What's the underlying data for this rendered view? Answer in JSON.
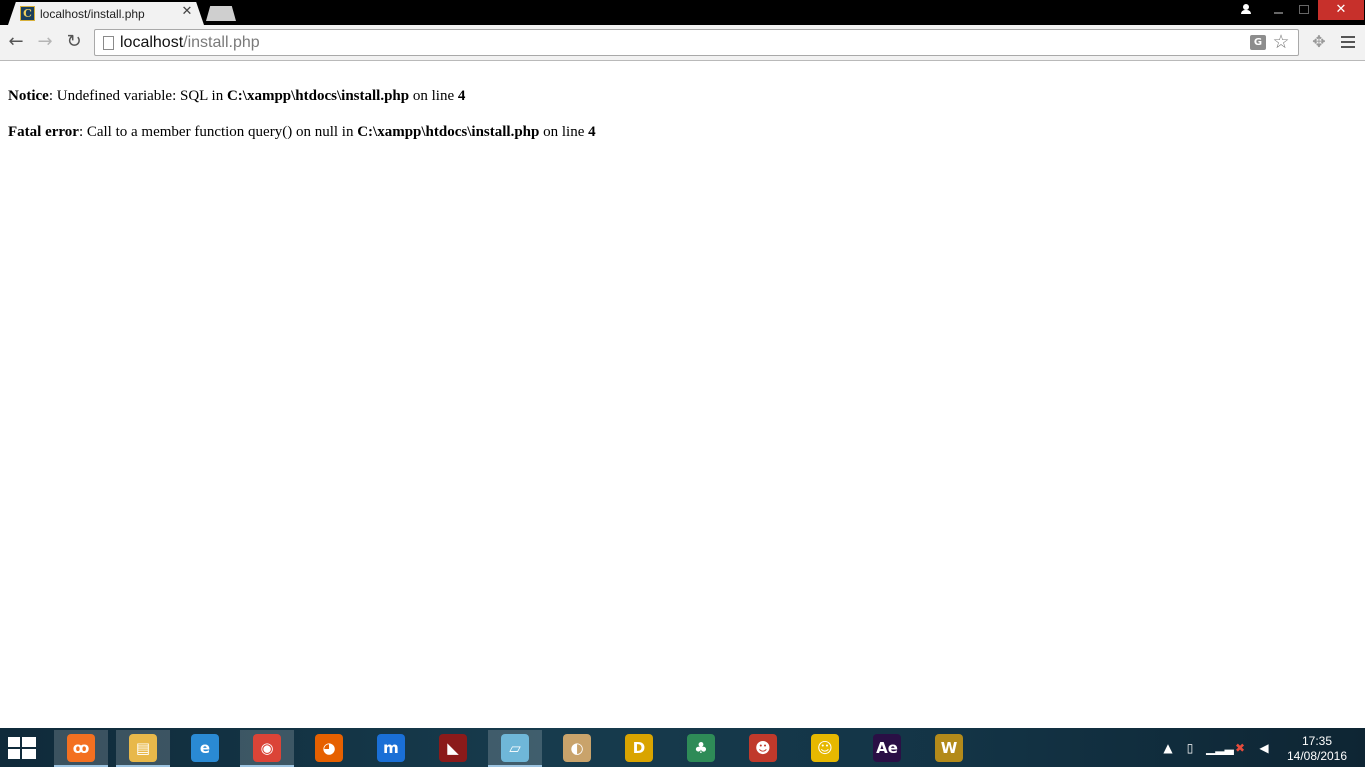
{
  "browser": {
    "tab_title": "localhost/install.php",
    "tab_close_glyph": "✕",
    "url_host": "localhost",
    "url_path": "/install.php",
    "window_close_glyph": "✕"
  },
  "page": {
    "messages": [
      {
        "label": "Notice",
        "text": ": Undefined variable: SQL in ",
        "file": "C:\\xampp\\htdocs\\install.php",
        "line_prefix": " on line ",
        "line": "4"
      },
      {
        "label": "Fatal error",
        "text": ": Call to a member function query() on null in ",
        "file": "C:\\xampp\\htdocs\\install.php",
        "line_prefix": " on line ",
        "line": "4"
      }
    ]
  },
  "taskbar": {
    "apps": [
      {
        "name": "xampp-icon",
        "glyph": "ꝏ",
        "color": "#f37021",
        "active": true
      },
      {
        "name": "file-explorer-icon",
        "glyph": "▤",
        "color": "#e8b84a",
        "active": true
      },
      {
        "name": "internet-explorer-icon",
        "glyph": "e",
        "color": "#2a8ad4",
        "active": false
      },
      {
        "name": "chrome-icon",
        "glyph": "◉",
        "color": "#db4437",
        "active": true
      },
      {
        "name": "firefox-icon",
        "glyph": "◕",
        "color": "#e66000",
        "active": false
      },
      {
        "name": "maxthon-icon",
        "glyph": "m",
        "color": "#1a6fd6",
        "active": false
      },
      {
        "name": "racing-game-icon",
        "glyph": "◣",
        "color": "#8b1a1a",
        "active": false
      },
      {
        "name": "notes-app-icon",
        "glyph": "▱",
        "color": "#6fb7d8",
        "active": true
      },
      {
        "name": "paint-icon",
        "glyph": "◐",
        "color": "#c9a36b",
        "active": false
      },
      {
        "name": "d-app-icon",
        "glyph": "D",
        "color": "#d9a400",
        "active": false
      },
      {
        "name": "mahjong-icon",
        "glyph": "♣",
        "color": "#2e8b57",
        "active": false
      },
      {
        "name": "game-character-icon",
        "glyph": "☻",
        "color": "#c0392b",
        "active": false
      },
      {
        "name": "hardhat-game-icon",
        "glyph": "☺",
        "color": "#e6b800",
        "active": false
      },
      {
        "name": "after-effects-icon",
        "glyph": "Ae",
        "color": "#2a0f45",
        "active": false
      },
      {
        "name": "world-of-warcraft-icon",
        "glyph": "W",
        "color": "#b38a1a",
        "active": false
      }
    ],
    "tray_chevron": "▲",
    "tray_volume": "◀",
    "clock_time": "17:35",
    "clock_date": "14/08/2016"
  }
}
